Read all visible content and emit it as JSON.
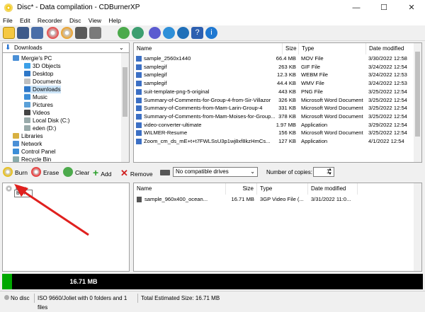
{
  "window": {
    "title": "Disc* - Data compilation - CDBurnerXP",
    "minimize": "—",
    "maximize": "☐",
    "close": "✕"
  },
  "menu": [
    "File",
    "Edit",
    "Recorder",
    "Disc",
    "View",
    "Help"
  ],
  "toolbar_icons": [
    "new-icon",
    "open-icon",
    "save-icon",
    "cd-burn-icon",
    "cd-add-icon",
    "drive-icon",
    "copy-disc-icon",
    "back-icon",
    "refresh-icon",
    "settings-icon",
    "globe-icon",
    "help-icon",
    "info-icon"
  ],
  "tree": {
    "location": "Downloads",
    "items": [
      {
        "label": "Mergie's PC",
        "icon": "pc-icon"
      },
      {
        "label": "3D Objects",
        "icon": "folder-icon"
      },
      {
        "label": "Desktop",
        "icon": "folder-icon"
      },
      {
        "label": "Documents",
        "icon": "folder-icon"
      },
      {
        "label": "Downloads",
        "icon": "download-folder-icon"
      },
      {
        "label": "Music",
        "icon": "music-icon"
      },
      {
        "label": "Pictures",
        "icon": "pictures-icon"
      },
      {
        "label": "Videos",
        "icon": "videos-icon"
      },
      {
        "label": "Local Disk (C:)",
        "icon": "disk-icon"
      },
      {
        "label": "eden (D:)",
        "icon": "disk-icon"
      },
      {
        "label": "Libraries",
        "icon": "libraries-icon"
      },
      {
        "label": "Network",
        "icon": "network-icon"
      },
      {
        "label": "Control Panel",
        "icon": "control-panel-icon"
      },
      {
        "label": "Recycle Bin",
        "icon": "recycle-icon"
      }
    ]
  },
  "files": {
    "columns": [
      "Name",
      "Size",
      "Type",
      "Date modified"
    ],
    "rows": [
      {
        "name": "sample_2560x1440",
        "size": "66.4 MB",
        "type": "MOV File",
        "date": "3/30/2022 12:58"
      },
      {
        "name": "samplegif",
        "size": "263 KB",
        "type": "GIF File",
        "date": "3/24/2022 12:54"
      },
      {
        "name": "samplegif",
        "size": "12.3 KB",
        "type": "WEBM File",
        "date": "3/24/2022 12:53"
      },
      {
        "name": "samplegif",
        "size": "44.4 KB",
        "type": "WMV File",
        "date": "3/24/2022 12:53"
      },
      {
        "name": "suit-template-png-5-original",
        "size": "443 KB",
        "type": "PNG File",
        "date": "3/25/2022 12:54"
      },
      {
        "name": "Summary-of-Comments-for-Group-4-from-Sir-Villazor",
        "size": "326 KB",
        "type": "Microsoft Word Document",
        "date": "3/25/2022 12:54"
      },
      {
        "name": "Summary-of-Comments-from-Mam-Larin-Group-4",
        "size": "331 KB",
        "type": "Microsoft Word Document",
        "date": "3/25/2022 12:54"
      },
      {
        "name": "Summary-of-Comments-from-Mam-Moises-for-Group...",
        "size": "378 KB",
        "type": "Microsoft Word Document",
        "date": "3/25/2022 12:54"
      },
      {
        "name": "video-converter-ultimate",
        "size": "1.97 MB",
        "type": "Application",
        "date": "3/29/2022 12:54"
      },
      {
        "name": "WILMER-Resume",
        "size": "156 KB",
        "type": "Microsoft Word Document",
        "date": "3/25/2022 12:54"
      },
      {
        "name": "Zoom_cm_ds_mE+t+t7FWLSsU3p1wj8xf8kzHmCs...",
        "size": "127 KB",
        "type": "Application",
        "date": "4/1/2022 12:54"
      }
    ]
  },
  "compilation": {
    "burn": "Burn",
    "erase": "Erase",
    "clear": "Clear",
    "add": "Add",
    "remove": "Remove",
    "drive": "No compatible drives",
    "copies_label": "Number of copies:",
    "copies": "1"
  },
  "disc": {
    "root": "Disc",
    "tooltip": "Burn",
    "columns": [
      "Name",
      "Size",
      "Type",
      "Date modified"
    ],
    "rows": [
      {
        "name": "sample_960x400_ocean...",
        "size": "16.71 MB",
        "type": "3GP Video File (...",
        "date": "3/31/2022 11:0..."
      }
    ]
  },
  "progress": {
    "label": "16.71 MB",
    "fraction": 0.023,
    "colors": {
      "fill": "#00a800",
      "bar": "#000000"
    }
  },
  "status": {
    "disc": "No disc",
    "fs": "ISO 9660/Joliet with 0 folders and 1 files",
    "total": "Total Estimated Size: 16.71 MB"
  },
  "colors": {
    "accent": "#0078d7",
    "arrow": "#e0201e"
  }
}
